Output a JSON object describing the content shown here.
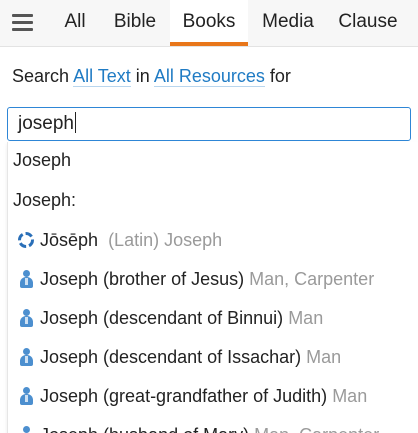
{
  "tabs": [
    {
      "label": "All"
    },
    {
      "label": "Bible"
    },
    {
      "label": "Books",
      "active": true
    },
    {
      "label": "Media"
    },
    {
      "label": "Clause"
    }
  ],
  "search": {
    "prefix": "Search",
    "scope": "All Text",
    "in": "in",
    "resources": "All Resources",
    "for": "for",
    "value": "joseph"
  },
  "suggestions": [
    {
      "label": "Joseph",
      "type": "plain"
    },
    {
      "label": "Joseph:",
      "type": "plain"
    },
    {
      "label": "Jōsēph",
      "detail": "(Latin) Joseph",
      "icon": "language-ring-icon"
    },
    {
      "label": "Joseph (brother of Jesus)",
      "detail": "Man, Carpenter",
      "icon": "person-icon"
    },
    {
      "label": "Joseph (descendant of Binnui)",
      "detail": "Man",
      "icon": "person-icon"
    },
    {
      "label": "Joseph (descendant of Issachar)",
      "detail": "Man",
      "icon": "person-icon"
    },
    {
      "label": "Joseph (great-grandfather of Judith)",
      "detail": "Man",
      "icon": "person-icon"
    },
    {
      "label": "Joseph (husband of Mary)",
      "detail": "Man, Carpenter",
      "icon": "person-icon"
    }
  ],
  "colors": {
    "accent": "#e8761a",
    "link": "#1f7bc4",
    "icon": "#4c8fcf",
    "muted": "#9a9a9a"
  }
}
